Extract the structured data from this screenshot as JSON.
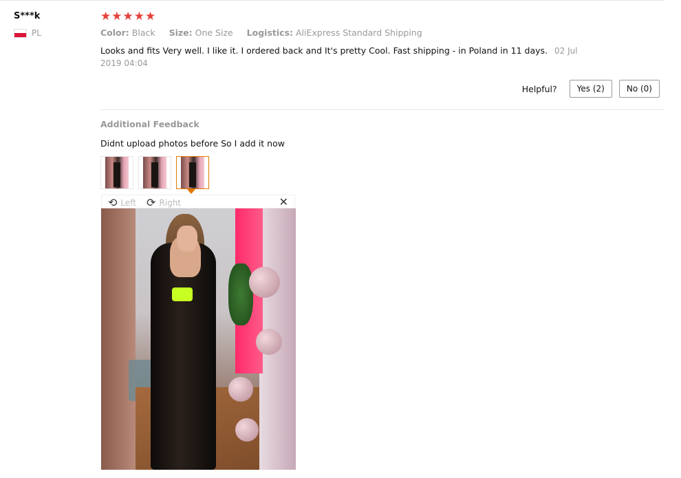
{
  "review": {
    "user_name": "S***k",
    "country": "PL",
    "stars": [
      "★",
      "★",
      "★",
      "★",
      "★"
    ],
    "rating_color": "#e5403a",
    "color_label": "Color:",
    "color_value": "Black",
    "size_label": "Size:",
    "size_value": "One Size",
    "logistics_label": "Logistics:",
    "logistics_value": "AliExpress Standard Shipping",
    "text": "Looks and fits Very well. I like it. I ordered back and It's pretty Cool. Fast shipping - in Poland in 11 days.",
    "date": "02 Jul 2019 04:04",
    "helpful_label": "Helpful?",
    "yes_label": "Yes (2)",
    "no_label": "No (0)"
  },
  "additional": {
    "title": "Additional Feedback",
    "text": "Didnt upload photos before So I add it now",
    "thumbnails": 3,
    "selected_thumbnail": 3
  },
  "viewer": {
    "rotate_left_label": "Left",
    "rotate_right_label": "Right",
    "rotate_left_icon": "rotate-left-icon",
    "rotate_right_icon": "rotate-right-icon",
    "close_icon": "close-icon",
    "close_glyph": "✕",
    "rotate_left_glyph": "⟲",
    "rotate_right_glyph": "⟳"
  }
}
